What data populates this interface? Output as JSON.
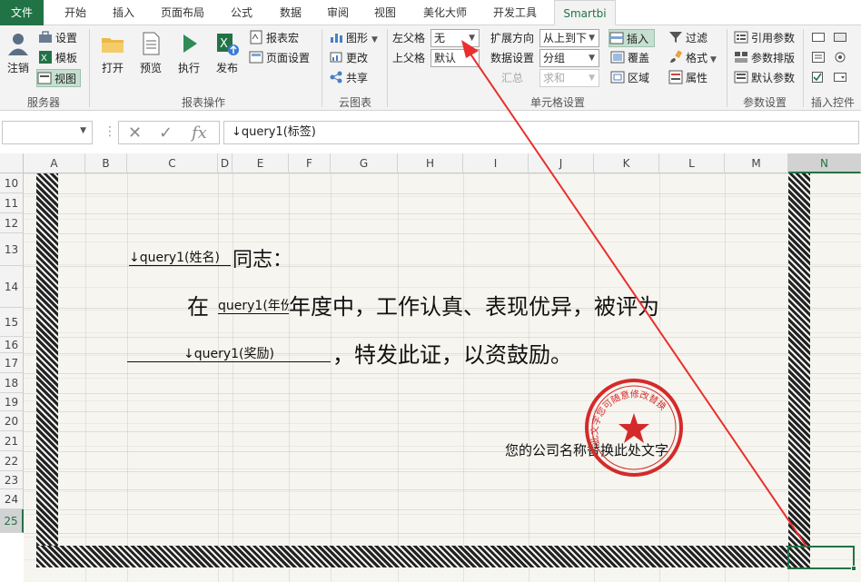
{
  "tabs": [
    "文件",
    "开始",
    "插入",
    "页面布局",
    "公式",
    "数据",
    "审阅",
    "视图",
    "美化大师",
    "开发工具",
    "Smartbi"
  ],
  "ribbon": {
    "server": {
      "login": "注销",
      "settings": "设置",
      "template": "模板",
      "view": "视图",
      "label": "服务器"
    },
    "report": {
      "open": "打开",
      "preview": "预览",
      "execute": "执行",
      "publish": "发布",
      "macro": "报表宏",
      "page_setup": "页面设置",
      "label": "报表操作"
    },
    "cloud": {
      "graphic": "图形",
      "change": "更改",
      "share": "共享",
      "label": "云图表"
    },
    "cell": {
      "left_parent_label": "左父格",
      "left_parent_value": "无",
      "top_parent_label": "上父格",
      "top_parent_value": "默认",
      "expand_dir_label": "扩展方向",
      "expand_dir_value": "从上到下",
      "data_setting_label": "数据设置",
      "data_setting_value": "分组",
      "summary_label": "汇总",
      "summary_value": "求和",
      "insert": "插入",
      "cover": "覆盖",
      "area": "区域",
      "filter": "过滤",
      "format": "格式",
      "property": "属性",
      "label": "单元格设置"
    },
    "params": {
      "ref": "引用参数",
      "sort": "参数排版",
      "default": "默认参数",
      "label": "参数设置"
    },
    "controls": {
      "label": "插入控件"
    }
  },
  "formula_bar": {
    "name_box": "",
    "content": "↓query1(标签)"
  },
  "columns": [
    "A",
    "B",
    "C",
    "D",
    "E",
    "F",
    "G",
    "H",
    "I",
    "J",
    "K",
    "L",
    "M",
    "N"
  ],
  "selected_column": "N",
  "rows": [
    "10",
    "11",
    "12",
    "13",
    "14",
    "15",
    "16",
    "17",
    "18",
    "19",
    "20",
    "21",
    "22",
    "23",
    "24",
    "25"
  ],
  "selected_row": "25",
  "certificate": {
    "field_name": "↓query1(姓名)",
    "line1_suffix": "同志：",
    "line2_prefix": "在",
    "field_year": "query1(年份",
    "line2_suffix": "年度中，工作认真、表现优异，被评为",
    "field_award": "↓query1(奖励)",
    "line3_suffix": "，特发此证，以资鼓励。",
    "company": "您的公司名称替换此处文字",
    "stamp_text": "此文字您可随意修改替换"
  },
  "colors": {
    "excel_green": "#217346",
    "stamp_red": "#d42a2a",
    "arrow_red": "#e8302f"
  }
}
